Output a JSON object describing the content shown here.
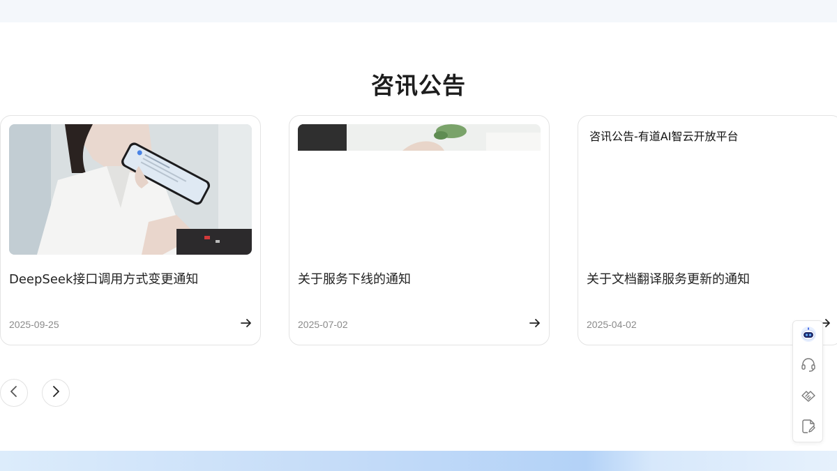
{
  "section": {
    "title": "咨讯公告"
  },
  "cards": [
    {
      "title": "DeepSeek接口调用方式变更通知",
      "date": "2025-09-25",
      "image": "woman-holding-phone-photo"
    },
    {
      "title": "关于服务下线的通知",
      "date": "2025-07-02",
      "image": "office-desk-photo-partial"
    },
    {
      "title": "关于文档翻译服务更新的通知",
      "date": "2025-04-02",
      "image_alt": "咨讯公告-有道AI智云开放平台"
    }
  ],
  "carousel": {
    "prev_icon": "chevron-left-icon",
    "next_icon": "chevron-right-icon"
  },
  "side_toolbar": {
    "items": [
      {
        "icon": "robot-assistant-icon"
      },
      {
        "icon": "headset-icon"
      },
      {
        "icon": "handshake-icon"
      },
      {
        "icon": "edit-document-icon"
      }
    ]
  },
  "colors": {
    "accent": "#2b4fd6",
    "border": "#e3e3e3",
    "muted_text": "#8a8a8a"
  }
}
